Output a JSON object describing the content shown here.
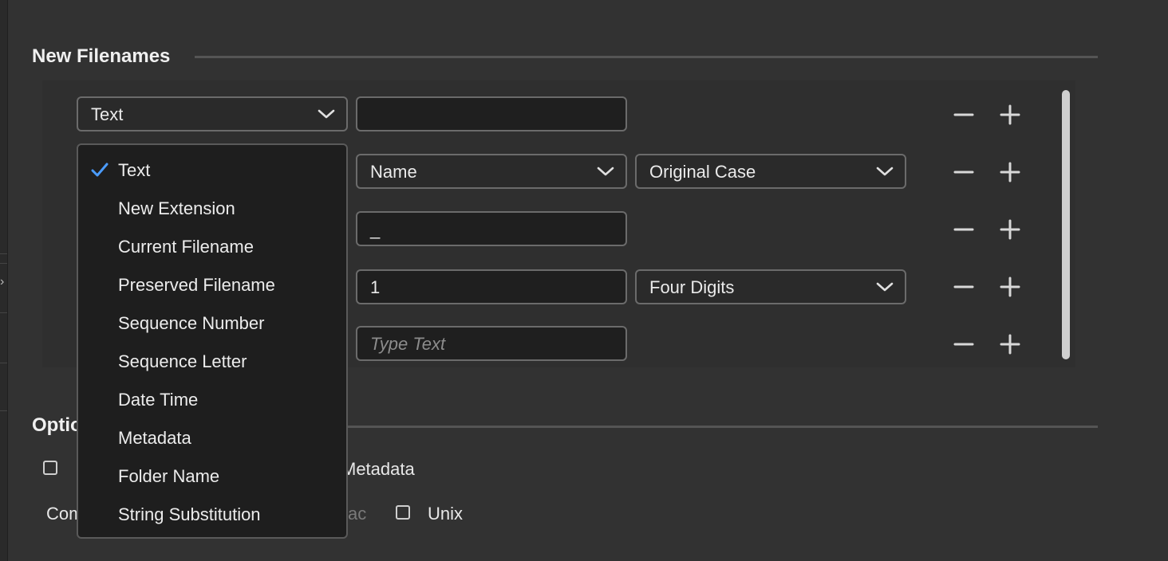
{
  "sections": {
    "new_filenames_title": "New Filenames",
    "options_title_partial": "Optio"
  },
  "rows": [
    {
      "type_select": "Text",
      "text_value": "",
      "text_placeholder": ""
    },
    {
      "field_select": "Name",
      "case_select": "Original Case"
    },
    {
      "text_value": "_"
    },
    {
      "number_value": "1",
      "digits_select": "Four Digits"
    },
    {
      "text_value": "",
      "text_placeholder": "Type Text"
    }
  ],
  "row_buttons": {
    "minus_icon": "minus-icon",
    "plus_icon": "plus-icon"
  },
  "dropdown": {
    "selected": "Text",
    "items": [
      "Text",
      "New Extension",
      "Current Filename",
      "Preserved Filename",
      "Sequence Number",
      "Sequence Letter",
      "Date Time",
      "Metadata",
      "Folder Name",
      "String Substitution"
    ]
  },
  "options": {
    "preserve_metadata_partial": "Metadata",
    "compat_partial": "Com",
    "mac_partial": "ac",
    "unix_label": "Unix"
  },
  "colors": {
    "background": "#323232",
    "accent_check": "#4b9cff"
  }
}
